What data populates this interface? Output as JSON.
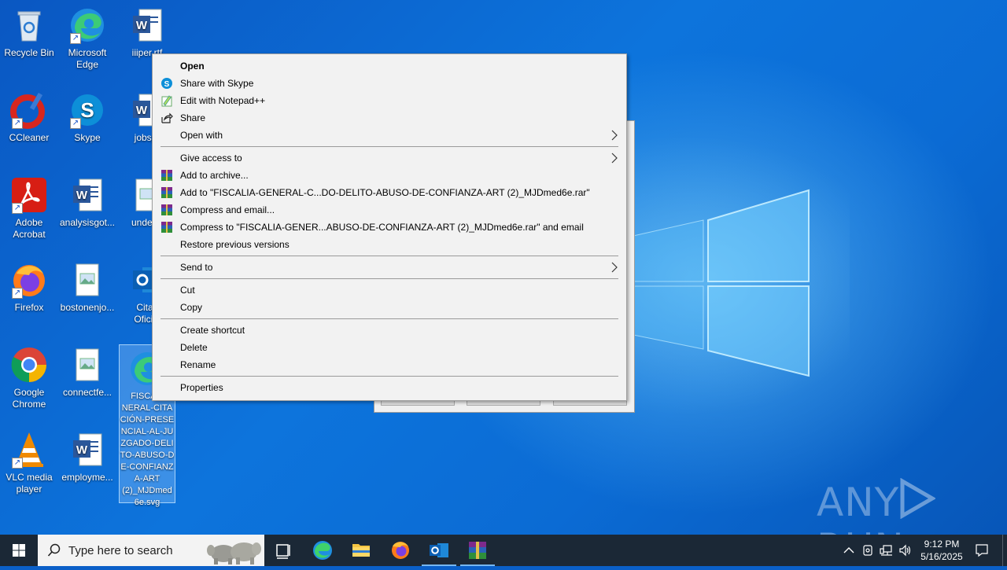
{
  "desktop": {
    "icons": [
      {
        "label": "Recycle Bin",
        "icon": "recycle-bin-icon"
      },
      {
        "label": "Microsoft Edge",
        "icon": "edge-icon"
      },
      {
        "label": "iiiper.rtf",
        "icon": "word-doc-icon"
      },
      {
        "label": "CCleaner",
        "icon": "ccleaner-icon"
      },
      {
        "label": "Skype",
        "icon": "skype-icon"
      },
      {
        "label": "jobspr",
        "icon": "word-doc-icon"
      },
      {
        "label": "Adobe Acrobat",
        "icon": "acrobat-icon"
      },
      {
        "label": "analysisgot...",
        "icon": "word-doc-icon"
      },
      {
        "label": "underst",
        "icon": "image-file-icon"
      },
      {
        "label": "Firefox",
        "icon": "firefox-icon"
      },
      {
        "label": "bostonenjo...",
        "icon": "image-file-icon"
      },
      {
        "label": "Citac Oficial",
        "icon": "outlook-icon"
      },
      {
        "label": "Google Chrome",
        "icon": "chrome-icon"
      },
      {
        "label": "connectfe...",
        "icon": "image-file-icon"
      },
      {
        "label": "FISCALIA-GENERAL-CITACIÓN-PRESENCIAL-AL-JUZGADO-DELITO-ABUSO-DE-CONFIANZA-ART (2)_MJDmed6e.svg",
        "display": "FISCALI\nNERAL-CITA\nCIÓN-PRESE\nNCIAL-AL-JU\nZGADO-DELI\nTO-ABUSO-D\nE-CONFIANZ\nA-ART\n(2)_MJDmed\n6e.svg",
        "icon": "edge-icon"
      },
      {
        "label": "VLC media player",
        "icon": "vlc-icon"
      },
      {
        "label": "employme...",
        "icon": "word-doc-icon"
      }
    ]
  },
  "context_menu": {
    "items": [
      {
        "label": "Open",
        "bold": true
      },
      {
        "label": "Share with Skype",
        "icon": "skype-icon"
      },
      {
        "label": "Edit with Notepad++",
        "icon": "notepadpp-icon"
      },
      {
        "label": "Share",
        "icon": "share-icon"
      },
      {
        "label": "Open with",
        "submenu": true
      },
      {
        "label": "Give access to",
        "submenu": true
      },
      {
        "label": "Add to archive...",
        "icon": "winrar-icon"
      },
      {
        "label": "Add to \"FISCALIA-GENERAL-C...DO-DELITO-ABUSO-DE-CONFIANZA-ART (2)_MJDmed6e.rar\"",
        "icon": "winrar-icon"
      },
      {
        "label": "Compress and email...",
        "icon": "winrar-icon"
      },
      {
        "label": "Compress to \"FISCALIA-GENER...ABUSO-DE-CONFIANZA-ART (2)_MJDmed6e.rar\" and email",
        "icon": "winrar-icon"
      },
      {
        "label": "Restore previous versions"
      },
      {
        "label": "Send to",
        "submenu": true
      },
      {
        "label": "Cut"
      },
      {
        "label": "Copy"
      },
      {
        "label": "Create shortcut"
      },
      {
        "label": "Delete"
      },
      {
        "label": "Rename"
      },
      {
        "label": "Properties"
      }
    ]
  },
  "taskbar": {
    "search_placeholder": "Type here to search",
    "apps": [
      "task-view-icon",
      "edge-icon",
      "file-explorer-icon",
      "firefox-icon",
      "outlook-icon",
      "winrar-icon"
    ],
    "clock_time": "9:12 PM",
    "clock_date": "5/16/2025"
  },
  "watermark": {
    "text_left": "ANY",
    "text_right": "RUN"
  },
  "colors": {
    "desktop_blue": "#0b6bd4",
    "taskbar": "#1b2836",
    "menu_bg": "#f2f2f2"
  }
}
